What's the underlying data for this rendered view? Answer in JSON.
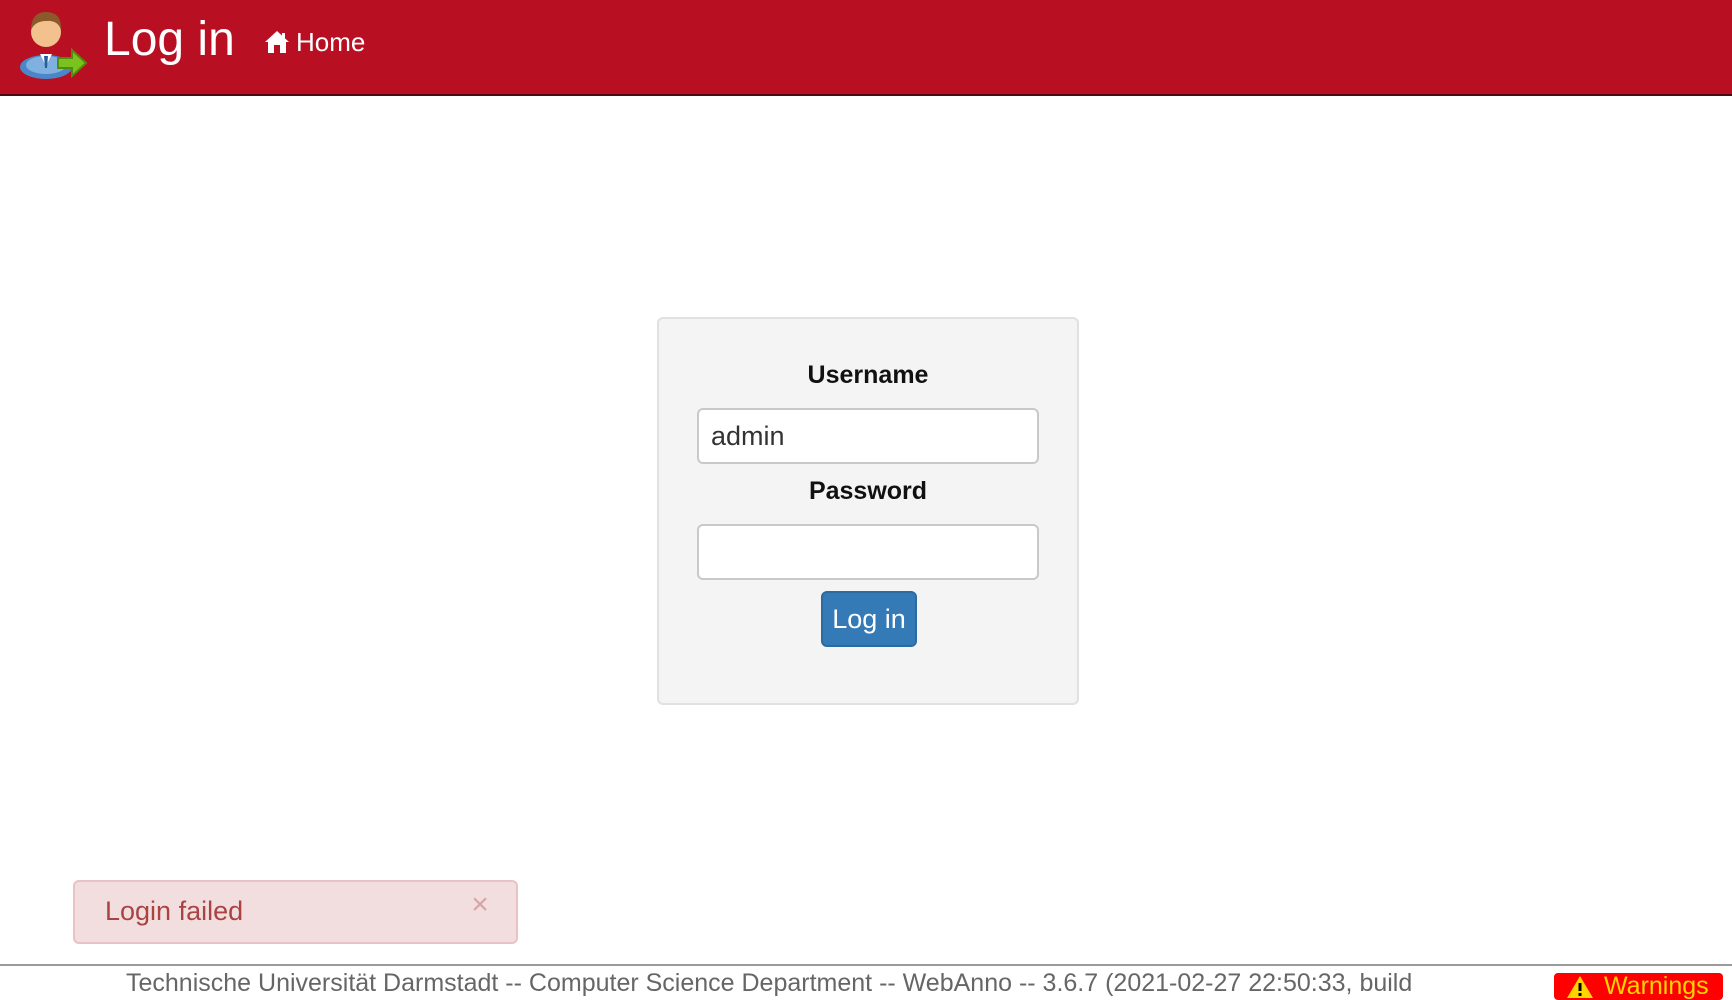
{
  "header": {
    "title": "Log in",
    "home_label": "Home",
    "logo_icon": "user-login-icon",
    "home_icon": "home-icon",
    "background_color": "#b80f22"
  },
  "login_form": {
    "username_label": "Username",
    "username_value": "admin",
    "password_label": "Password",
    "password_value": "",
    "submit_label": "Log in",
    "button_color": "#337ab7"
  },
  "alert": {
    "message": "Login failed",
    "close_icon": "close-icon",
    "color": "#a94442",
    "background": "#f2dede"
  },
  "footer": {
    "text": "Technische Universität Darmstadt -- Computer Science Department -- WebAnno -- 3.6.7 (2021-02-27 22:50:33, build",
    "warnings_label": "Warnings",
    "warnings_icon": "warning-icon",
    "warnings_background": "#ff0000"
  }
}
